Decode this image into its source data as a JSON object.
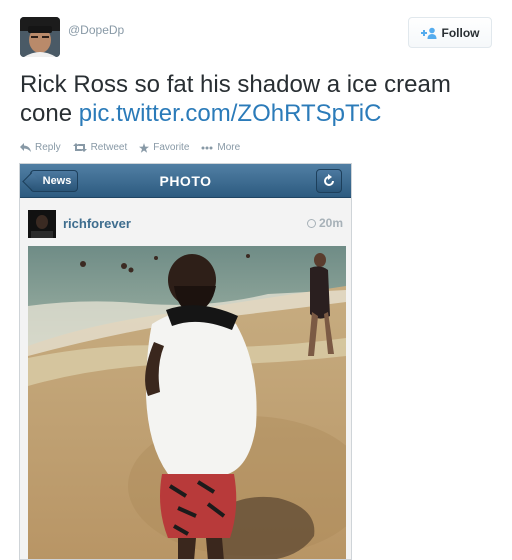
{
  "header": {
    "handle": "@DopeDp",
    "follow_label": "Follow"
  },
  "tweet": {
    "text": "Rick Ross so fat his shadow a ice cream cone ",
    "link": "pic.twitter.com/ZOhRTSpTiC"
  },
  "actions": [
    {
      "label": "Reply",
      "icon": "reply-icon"
    },
    {
      "label": "Retweet",
      "icon": "retweet-icon"
    },
    {
      "label": "Favorite",
      "icon": "star-icon"
    },
    {
      "label": "More",
      "icon": "more-icon"
    }
  ],
  "media": {
    "back_label": "News",
    "title": "PHOTO",
    "username": "richforever",
    "time": "20m"
  },
  "colors": {
    "link": "#2b7bb9",
    "muted": "#8899a6",
    "instagram_bar": "#2d5b80"
  }
}
